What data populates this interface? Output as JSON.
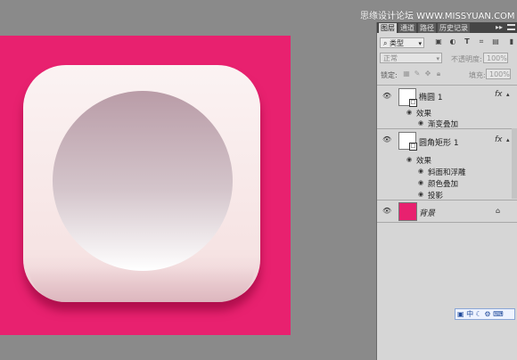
{
  "watermark": "思缘设计论坛  WWW.MISSYUAN.COM",
  "tabs": [
    "图层",
    "通道",
    "路径",
    "历史记录"
  ],
  "tabs_more": "▸▸",
  "filter": {
    "kind": "类型"
  },
  "blend_mode": "正常",
  "opacity": {
    "label": "不透明度:",
    "value": "100%"
  },
  "lock": {
    "label": "锁定:"
  },
  "fill": {
    "label": "填充:",
    "value": "100%"
  },
  "layers": [
    {
      "name": "椭圆 1",
      "fx": "fx",
      "effects_label": "效果",
      "effects": [
        "渐变叠加"
      ]
    },
    {
      "name": "圆角矩形 1",
      "fx": "fx",
      "effects_label": "效果",
      "effects": [
        "斜面和浮雕",
        "颜色叠加",
        "投影"
      ]
    },
    {
      "name": "背景",
      "swatch_color": "#e8216f",
      "locked": true
    }
  ],
  "ime": {
    "text": "中"
  },
  "colors": {
    "canvas": "#e8216f",
    "workspace": "#8a8a8a",
    "panel": "#d6d6d6"
  }
}
